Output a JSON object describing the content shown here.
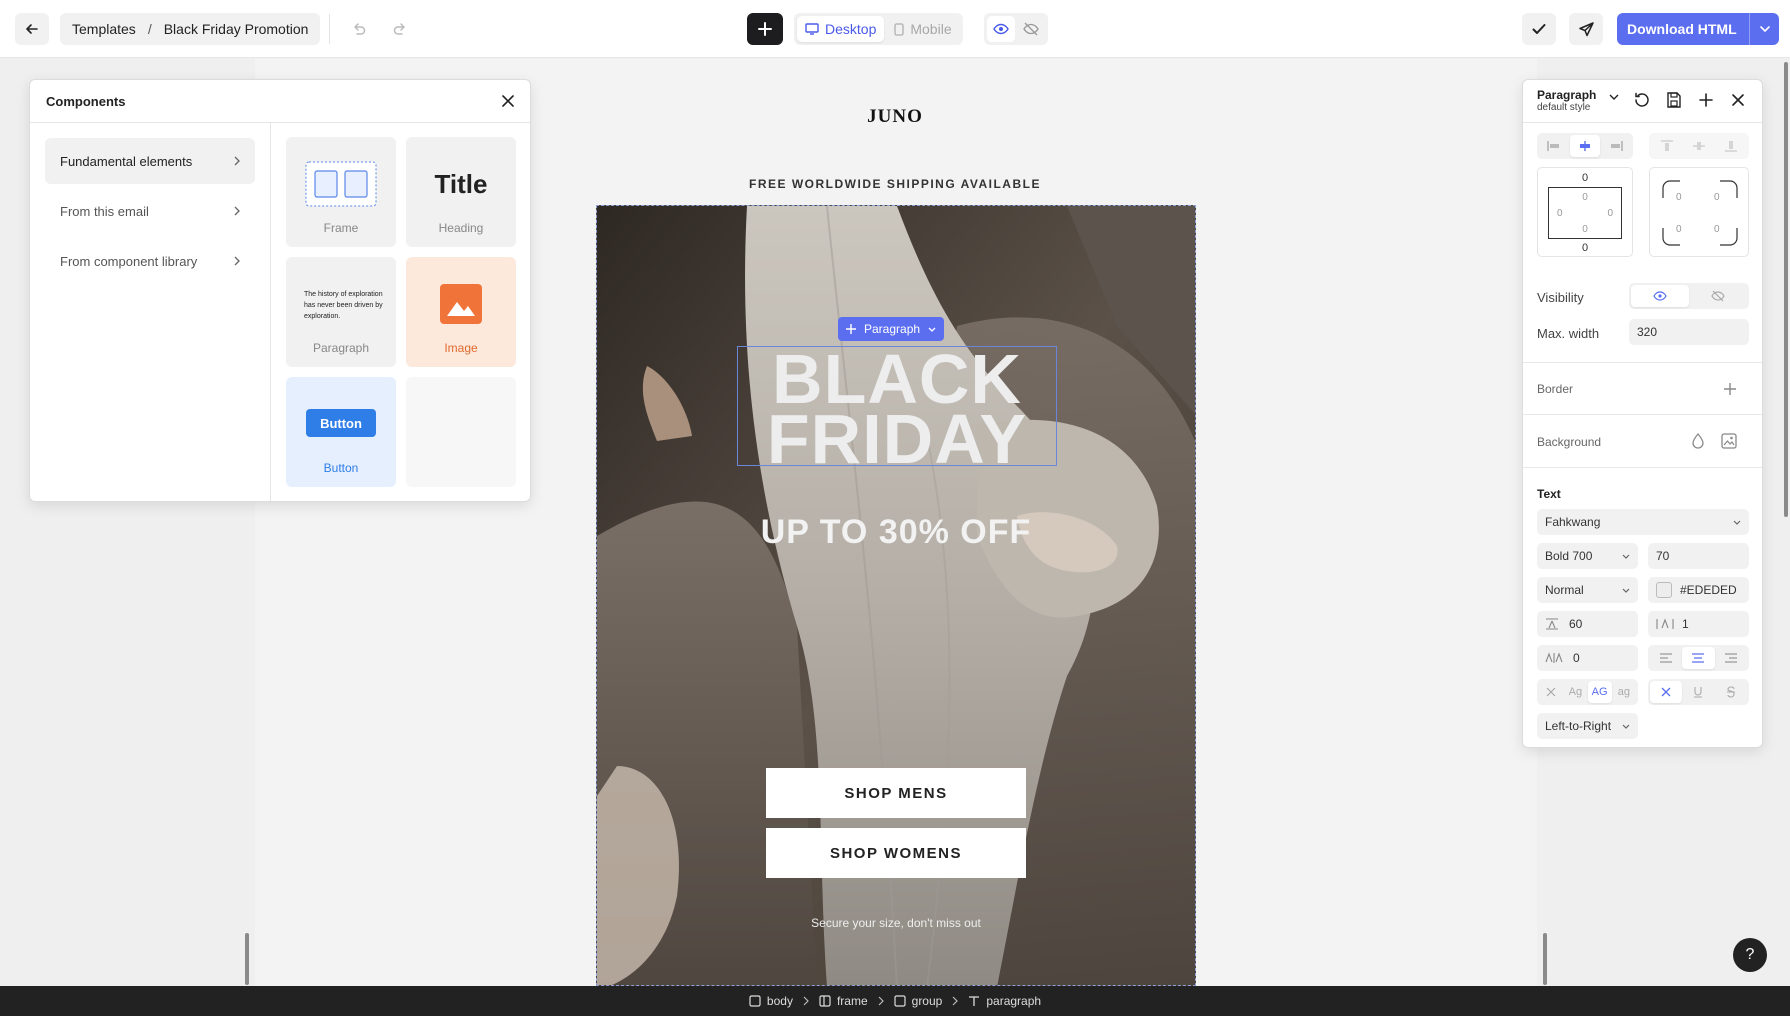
{
  "topbar": {
    "breadcrumb": {
      "root": "Templates",
      "separator": "/",
      "current": "Black Friday Promotion"
    },
    "device_tabs": [
      {
        "label": "Desktop",
        "icon": "monitor-icon",
        "active": true
      },
      {
        "label": "Mobile",
        "icon": "phone-icon",
        "active": false
      }
    ],
    "download_label": "Download HTML",
    "accent_color": "#5b6ef0"
  },
  "email": {
    "logo": "JUNO",
    "shipping_notice": "FREE WORLDWIDE SHIPPING AVAILABLE",
    "headline_line1": "BLACK",
    "headline_line2": "FRIDAY",
    "offer": "UP TO 30% OFF",
    "buttons": [
      "SHOP MENS",
      "SHOP WOMENS"
    ],
    "footnote": "Secure your size, don't miss out",
    "selected_badge": "Paragraph"
  },
  "components_panel": {
    "title": "Components",
    "categories": [
      {
        "label": "Fundamental elements",
        "active": true
      },
      {
        "label": "From this email",
        "active": false
      },
      {
        "label": "From component library",
        "active": false
      }
    ],
    "tiles": {
      "frame": "Frame",
      "heading_preview": "Title",
      "heading": "Heading",
      "paragraph_preview": "The history of exploration has never been driven by exploration.",
      "paragraph": "Paragraph",
      "image": "Image",
      "button_preview": "Button",
      "button": "Button"
    }
  },
  "properties": {
    "element": "Paragraph",
    "style": "default style",
    "padding": {
      "top": "0",
      "bottom": "0",
      "inner_top": "0",
      "inner_bottom": "0",
      "inner_left": "0",
      "inner_right": "0"
    },
    "radius": {
      "tl": "0",
      "tr": "0",
      "bl": "0",
      "br": "0"
    },
    "visibility_label": "Visibility",
    "max_width_label": "Max. width",
    "max_width": "320",
    "border_label": "Border",
    "background_label": "Background",
    "text_label": "Text",
    "font": "Fahkwang",
    "weight": "Bold 700",
    "size": "70",
    "style_select": "Normal",
    "color": "#EDEDED",
    "line_height": "60",
    "letter_height_value": "1",
    "letter_spacing": "0",
    "case_options": [
      "Ag",
      "AG",
      "ag"
    ],
    "direction": "Left-to-Right"
  },
  "footer": {
    "path": [
      "body",
      "frame",
      "group",
      "paragraph"
    ]
  },
  "help_label": "?"
}
